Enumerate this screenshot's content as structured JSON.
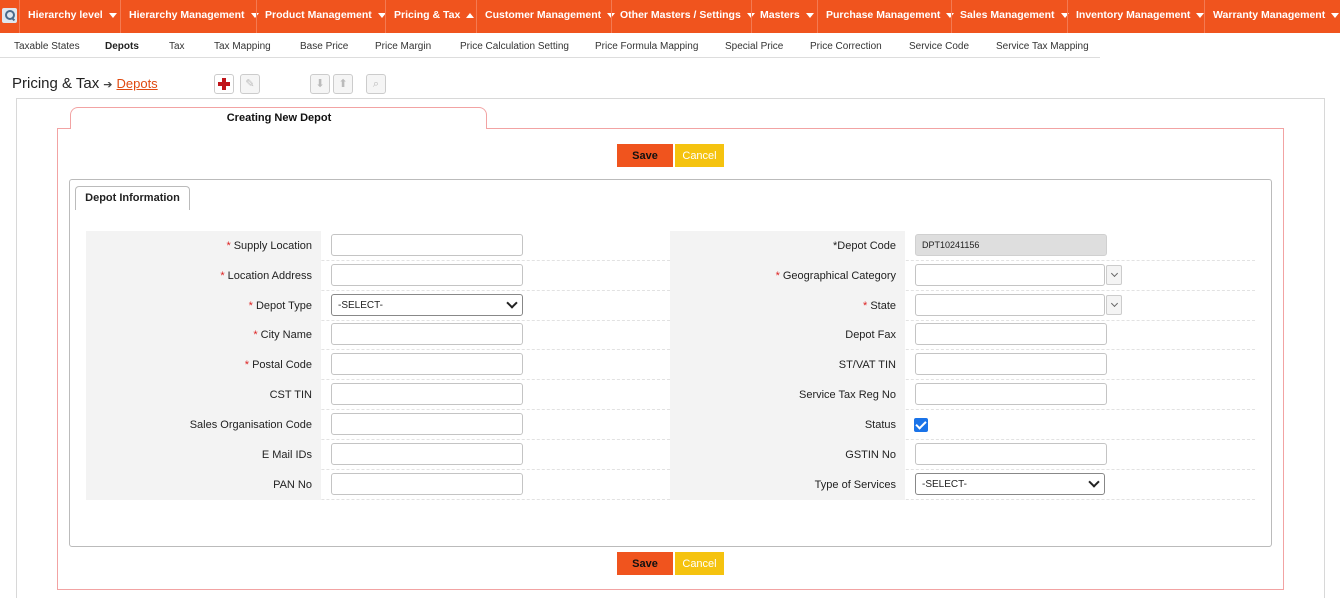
{
  "topnav": {
    "items": [
      {
        "label": "Hierarchy level",
        "caret": "down"
      },
      {
        "label": "Hierarchy Management",
        "caret": "down"
      },
      {
        "label": "Product Management",
        "caret": "down"
      },
      {
        "label": "Pricing & Tax",
        "caret": "up"
      },
      {
        "label": "Customer Management",
        "caret": "down"
      },
      {
        "label": "Other Masters / Settings",
        "caret": "down"
      },
      {
        "label": "Masters",
        "caret": "down"
      },
      {
        "label": "Purchase Management",
        "caret": "down"
      },
      {
        "label": "Sales Management",
        "caret": "down"
      },
      {
        "label": "Inventory Management",
        "caret": "down"
      },
      {
        "label": "Warranty Management",
        "caret": "down"
      }
    ]
  },
  "subnav": {
    "items": [
      "Taxable States",
      "Depots",
      "Tax",
      "Tax Mapping",
      "Base Price",
      "Price Margin",
      "Price Calculation Setting",
      "Price Formula Mapping",
      "Special Price",
      "Price Correction",
      "Service Code",
      "Service Tax Mapping"
    ],
    "active": "Depots"
  },
  "breadcrumb": {
    "section": "Pricing & Tax",
    "page": "Depots"
  },
  "panel": {
    "title": "Creating New Depot",
    "section_tab": "Depot Information"
  },
  "buttons": {
    "save": "Save",
    "cancel": "Cancel"
  },
  "form": {
    "left": [
      {
        "label": "Supply Location",
        "required": true,
        "value": ""
      },
      {
        "label": "Location Address",
        "required": true,
        "value": ""
      },
      {
        "label": "Depot Type",
        "required": true,
        "value": "-SELECT-",
        "type": "select"
      },
      {
        "label": "City Name",
        "required": true,
        "value": ""
      },
      {
        "label": "Postal Code",
        "required": true,
        "value": ""
      },
      {
        "label": "CST TIN",
        "required": false,
        "value": ""
      },
      {
        "label": "Sales Organisation Code",
        "required": false,
        "value": ""
      },
      {
        "label": "E Mail IDs",
        "required": false,
        "value": ""
      },
      {
        "label": "PAN No",
        "required": false,
        "value": ""
      }
    ],
    "right": [
      {
        "label": "*Depot Code",
        "required": false,
        "value": "DPT10241156",
        "type": "readonly"
      },
      {
        "label": "Geographical Category",
        "required": true,
        "value": "",
        "type": "combo"
      },
      {
        "label": "State",
        "required": true,
        "value": "",
        "type": "combo"
      },
      {
        "label": "Depot Fax",
        "required": false,
        "value": ""
      },
      {
        "label": "ST/VAT TIN",
        "required": false,
        "value": ""
      },
      {
        "label": "Service Tax Reg No",
        "required": false,
        "value": ""
      },
      {
        "label": "Status",
        "required": false,
        "checked": true,
        "type": "checkbox"
      },
      {
        "label": "GSTIN No",
        "required": false,
        "value": ""
      },
      {
        "label": "Type of Services",
        "required": false,
        "value": "-SELECT-",
        "type": "select"
      }
    ]
  },
  "colors": {
    "brand": "#f0541e",
    "cancel": "#f5c30f",
    "panel_border": "#f2a3a3",
    "required": "#dd2222",
    "checkbox": "#1a73e8"
  }
}
